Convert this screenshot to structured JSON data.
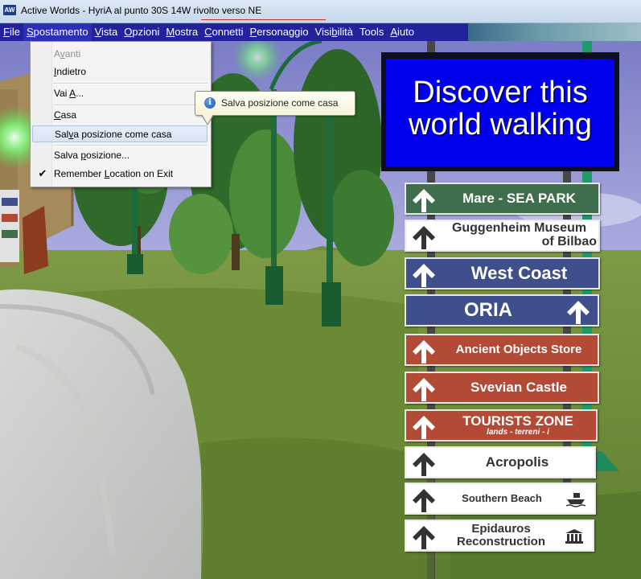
{
  "window": {
    "app_icon": "AW",
    "title": "Active Worlds  - HyriA al punto 30S 14W  rivolto verso NE"
  },
  "menubar": {
    "items": [
      "File",
      "Spostamento",
      "Vista",
      "Opzioni",
      "Mostra",
      "Connetti",
      "Personaggio",
      "Visibilità",
      "Tools",
      "Aiuto"
    ],
    "active_index": 1
  },
  "dropdown": {
    "items": [
      {
        "label": "Avanti",
        "disabled": true
      },
      {
        "label": "Indietro"
      },
      {
        "label": "Vai A..."
      },
      {
        "label": "Casa"
      },
      {
        "label": "Salva posizione come casa",
        "highlighted": true
      },
      {
        "label": "Salva posizione..."
      },
      {
        "label": "Remember Location on Exit",
        "checked": true
      }
    ],
    "check_mark": "✔"
  },
  "tooltip": {
    "icon": "info-icon",
    "icon_glyph": "i",
    "text": "Salva posizione come casa"
  },
  "billboard": {
    "line1": "Discover this",
    "line2": "world walking",
    "bg_color": "#0000ee"
  },
  "signs": [
    {
      "text": "Mare - SEA PARK",
      "color": "#3f6e4c",
      "text_color": "#ffffff"
    },
    {
      "text": "Guggenheim Museum",
      "text2": "of Bilbao",
      "color": "#ffffff",
      "text_color": "#333333"
    },
    {
      "text": "West Coast",
      "color": "#3e4f8c",
      "text_color": "#ffffff"
    },
    {
      "text": "ORIA",
      "color": "#3e4f8c",
      "text_color": "#ffffff"
    },
    {
      "text": "Ancient Objects Store",
      "color": "#b24a36",
      "text_color": "#ffffff"
    },
    {
      "text": "Svevian Castle",
      "color": "#b24a36",
      "text_color": "#ffffff"
    },
    {
      "text": "TOURISTS ZONE",
      "sub": "lands - terreni - i",
      "color": "#b24a36",
      "text_color": "#ffffff"
    },
    {
      "text": "Acropolis",
      "color": "#ffffff",
      "text_color": "#333333"
    },
    {
      "text": "Southern Beach",
      "color": "#ffffff",
      "text_color": "#333333",
      "icon": "boat-icon"
    },
    {
      "text": "Epidauros",
      "text2": "Reconstruction",
      "color": "#ffffff",
      "text_color": "#333333",
      "icon": "temple-icon"
    }
  ]
}
